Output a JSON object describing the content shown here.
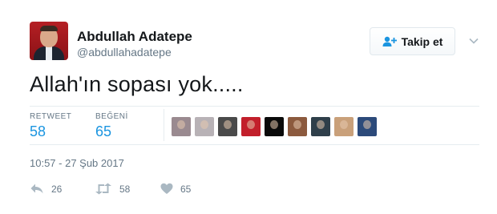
{
  "author": {
    "fullname": "Abdullah Adatepe",
    "username": "@abdullahadatepe"
  },
  "follow_button": {
    "label": "Takip et",
    "icon": "add-person-icon"
  },
  "tweet": {
    "text": "Allah'ın sopası yok....."
  },
  "stats": {
    "retweet_label": "RETWEET",
    "retweet_count": "58",
    "like_label": "BEĞENİ",
    "like_count": "65"
  },
  "likers": [
    {
      "name": "liker-avatar-1",
      "color": "#9a8a90"
    },
    {
      "name": "liker-avatar-2",
      "color": "#b8b2b6"
    },
    {
      "name": "liker-avatar-3",
      "color": "#4a4a4a"
    },
    {
      "name": "liker-avatar-4",
      "color": "#c21f2b"
    },
    {
      "name": "liker-avatar-5",
      "color": "#0a0a0a"
    },
    {
      "name": "liker-avatar-6",
      "color": "#8c5a3e"
    },
    {
      "name": "liker-avatar-7",
      "color": "#2f3f4a"
    },
    {
      "name": "liker-avatar-8",
      "color": "#c9a07a"
    },
    {
      "name": "liker-avatar-9",
      "color": "#2c4a7a"
    }
  ],
  "timestamp": "10:57 - 27 Şub 2017",
  "actions": {
    "reply_count": "26",
    "retweet_count": "58",
    "like_count": "65"
  },
  "colors": {
    "link_blue": "#1b95e0",
    "secondary_text": "#657786",
    "icon_gray": "#aab8c2",
    "divider": "#e6ecf0"
  }
}
